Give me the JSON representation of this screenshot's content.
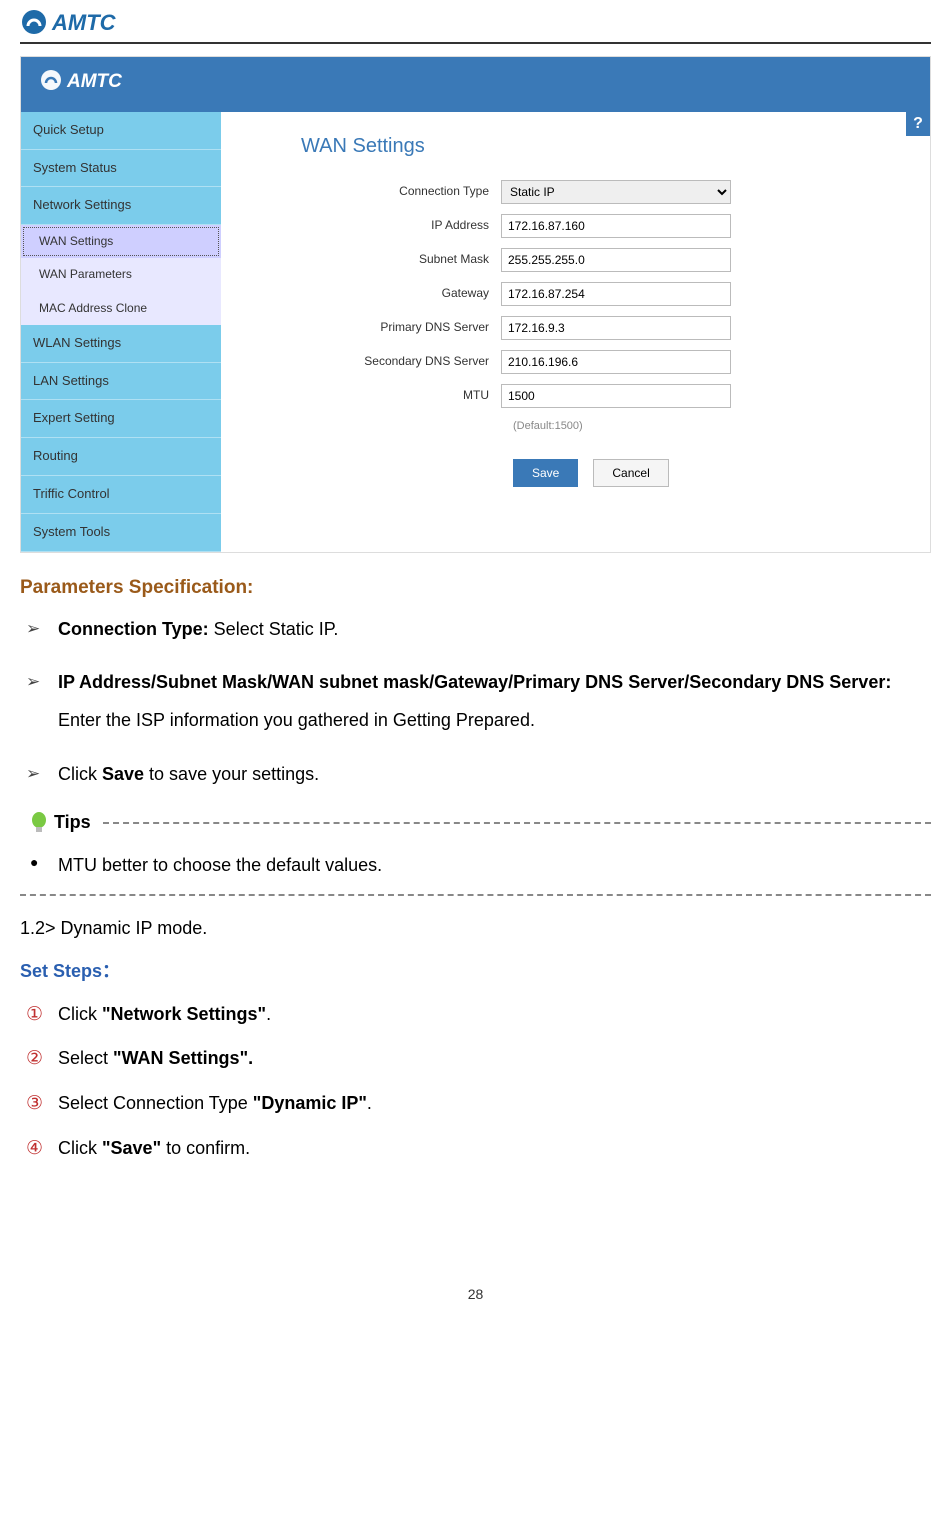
{
  "brand": {
    "name": "AMTC"
  },
  "router": {
    "sidebar": [
      {
        "label": "Quick Setup",
        "type": "item"
      },
      {
        "label": "System Status",
        "type": "item"
      },
      {
        "label": "Network Settings",
        "type": "item"
      },
      {
        "label": "WAN Settings",
        "type": "sub",
        "active": true
      },
      {
        "label": "WAN Parameters",
        "type": "sub"
      },
      {
        "label": "MAC Address Clone",
        "type": "sub"
      },
      {
        "label": "WLAN Settings",
        "type": "item"
      },
      {
        "label": "LAN Settings",
        "type": "item"
      },
      {
        "label": "Expert Setting",
        "type": "item"
      },
      {
        "label": "Routing",
        "type": "item"
      },
      {
        "label": "Triffic Control",
        "type": "item"
      },
      {
        "label": "System Tools",
        "type": "item"
      }
    ],
    "panel": {
      "title": "WAN Settings",
      "help": "?",
      "fields": {
        "connection_type": {
          "label": "Connection Type",
          "value": "Static IP"
        },
        "ip_address": {
          "label": "IP Address",
          "value": "172.16.87.160"
        },
        "subnet_mask": {
          "label": "Subnet Mask",
          "value": "255.255.255.0"
        },
        "gateway": {
          "label": "Gateway",
          "value": "172.16.87.254"
        },
        "primary_dns": {
          "label": "Primary DNS Server",
          "value": "172.16.9.3"
        },
        "secondary_dns": {
          "label": "Secondary DNS Server",
          "value": "210.16.196.6"
        },
        "mtu": {
          "label": "MTU",
          "value": "1500",
          "default_note": "(Default:1500)"
        }
      },
      "buttons": {
        "save": "Save",
        "cancel": "Cancel"
      }
    }
  },
  "doc": {
    "param_spec_heading": "Parameters Specification:",
    "spec_items": {
      "i1_bold": "Connection Type:",
      "i1_text": " Select Static IP.",
      "i2_bold": "IP Address/Subnet Mask/WAN subnet mask/Gateway/Primary DNS Server/Secondary DNS Server:",
      "i2_text": " Enter the ISP information you gathered in Getting Prepared.",
      "i3_pre": "Click ",
      "i3_bold": "Save",
      "i3_post": " to save your settings."
    },
    "tips_label": "Tips",
    "tips_body": "MTU better to choose the default values.",
    "subsection_label": "1.2> Dynamic IP mode.",
    "set_steps_label": "Set Steps：",
    "steps": {
      "s1": {
        "num": "①",
        "pre": "Click ",
        "bold": "\"Network Settings\"",
        "post": "."
      },
      "s2": {
        "num": "②",
        "pre": "Select ",
        "bold": "\"WAN Settings\".",
        "post": ""
      },
      "s3": {
        "num": "③",
        "pre": "Select Connection Type ",
        "bold": "\"Dynamic IP\"",
        "post": "."
      },
      "s4": {
        "num": "④",
        "pre": "Click ",
        "bold": "\"Save\"",
        "post": " to confirm."
      }
    },
    "page_number": "28"
  }
}
